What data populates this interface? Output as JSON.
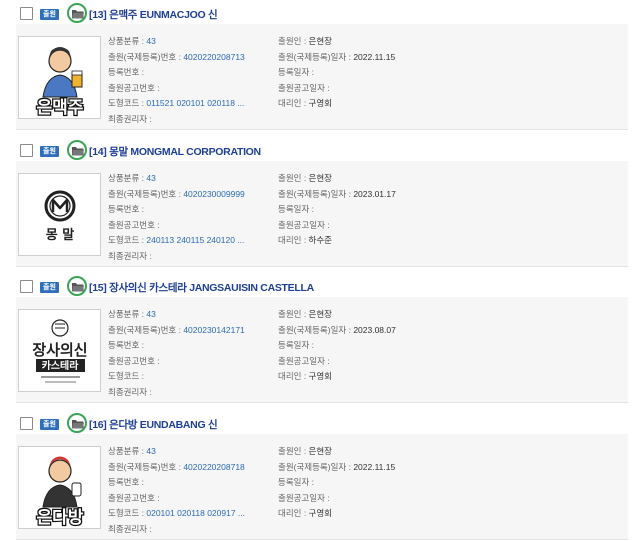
{
  "labels": {
    "class": "상품분류 : ",
    "appno": "출원(국제등록)번호 : ",
    "regno": "등록번호 : ",
    "pubno": "출원공고번호 : ",
    "figcode": "도형코드 : ",
    "holder": "최종권리자 : ",
    "applicant": "출원인 : ",
    "appdate": "출원(국제등록)일자 : ",
    "regdate": "등록일자 : ",
    "pubdate": "출원공고일자 : ",
    "agent": "대리인 : "
  },
  "records": [
    {
      "status": "출원",
      "title": "[13] 은맥주 EUNMACJOO 신",
      "class": "43",
      "appno": "4020220208713",
      "regno": "",
      "pubno": "",
      "figcode": "011521 020101 020118 ...",
      "holder": "",
      "applicant": "은현장",
      "appdate": "2022.11.15",
      "regdate": "",
      "pubdate": "",
      "agent": "구영회",
      "logo_text": "은맥주"
    },
    {
      "status": "출원",
      "title": "[14] 몽말 MONGMAL CORPORATION",
      "class": "43",
      "appno": "4020230009999",
      "regno": "",
      "pubno": "",
      "figcode": "240113 240115 240120 ...",
      "holder": "",
      "applicant": "은현장",
      "appdate": "2023.01.17",
      "regdate": "",
      "pubdate": "",
      "agent": "하수준",
      "logo_text": "몽 말"
    },
    {
      "status": "출원",
      "title": "[15] 장사의신 카스테라 JANGSAUISIN CASTELLA",
      "class": "43",
      "appno": "4020230142171",
      "regno": "",
      "pubno": "",
      "figcode": "",
      "holder": "",
      "applicant": "은현장",
      "appdate": "2023.08.07",
      "regdate": "",
      "pubdate": "",
      "agent": "구영회",
      "logo_text": "장사의신",
      "logo_sub": "카스테라"
    },
    {
      "status": "출원",
      "title": "[16] 은다방 EUNDABANG 신",
      "class": "43",
      "appno": "4020220208718",
      "regno": "",
      "pubno": "",
      "figcode": "020101 020118 020917 ...",
      "holder": "",
      "applicant": "은현장",
      "appdate": "2022.11.15",
      "regdate": "",
      "pubdate": "",
      "agent": "구영회",
      "logo_text": "은다방"
    }
  ]
}
